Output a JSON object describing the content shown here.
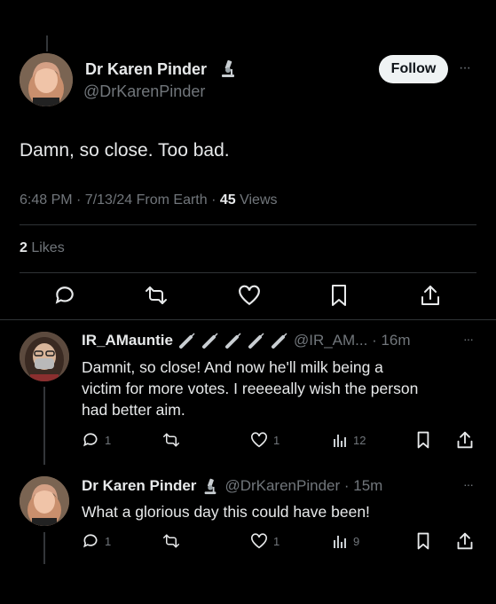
{
  "colors": {
    "background": "#000000",
    "text": "#e7e9ea",
    "secondary": "#71767b",
    "divider": "#2f3336"
  },
  "main_post": {
    "author_name": "Dr Karen Pinder",
    "handle": "@DrKarenPinder",
    "follow_label": "Follow",
    "more_label": "···",
    "text": "Damn, so close. Too bad.",
    "meta_prefix": "6:48 PM · 7/13/24 From Earth · ",
    "views_count": "45",
    "views_label": " Views",
    "likes_count": "2",
    "likes_label": " Likes",
    "badge_icon": "microscope-emoji",
    "actions": [
      "reply-icon",
      "retweet-icon",
      "heart-icon",
      "bookmark-icon",
      "share-icon"
    ]
  },
  "replies": [
    {
      "author_name": "IR_AMauntie",
      "emoji_icons": [
        "syringe",
        "syringe",
        "syringe",
        "syringe",
        "syringe"
      ],
      "handle_time": "@IR_AM... · 16m",
      "more_label": "···",
      "text_lines": [
        "Damnit, so close! And now he'll milk being a",
        "victim for more votes. I reeeeally wish the person",
        "had better aim."
      ],
      "reply_count": "1",
      "retweet_count": "",
      "like_count": "1",
      "views_count": "12"
    },
    {
      "author_name": "Dr Karen Pinder",
      "handle_time": "@DrKarenPinder · 15m",
      "more_label": "···",
      "text_lines": [
        "What a glorious day this could have been!"
      ],
      "reply_count": "1",
      "retweet_count": "",
      "like_count": "1",
      "views_count": "9"
    }
  ]
}
